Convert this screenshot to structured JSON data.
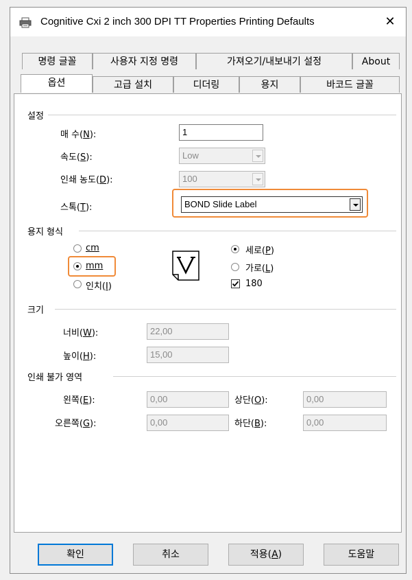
{
  "window": {
    "title": "Cognitive Cxi 2 inch 300 DPI TT Properties Printing Defaults",
    "close_glyph": "✕"
  },
  "tabs_row1": [
    "명령 글꼴",
    "사용자 지정 명령",
    "가져오기/내보내기 설정",
    "About"
  ],
  "tabs_row2": [
    "옵션",
    "고급 설치",
    "디더링",
    "용지",
    "바코드 글꼴"
  ],
  "active_tab": "옵션",
  "settings": {
    "group": "설정",
    "copies_label": "매 수(",
    "copies_key": "N",
    "copies_value": "1",
    "speed_label": "속도(",
    "speed_key": "S",
    "speed_value": "Low",
    "darkness_label": "인쇄 농도(",
    "darkness_key": "D",
    "darkness_value": "100",
    "stock_label": "스톡(",
    "stock_key": "T",
    "stock_value": "BOND Slide Label"
  },
  "paper_format": {
    "group": "용지 형식",
    "unit_cm": "cm",
    "unit_mm": "mm",
    "unit_inch": "인치(",
    "unit_inch_key": "I",
    "selected_unit": "mm",
    "portrait_label": "세로(",
    "portrait_key": "P",
    "landscape_label": "가로(",
    "landscape_key": "L",
    "selected_orientation": "portrait",
    "rotate_label": "180",
    "rotate_checked": true
  },
  "size": {
    "group": "크기",
    "width_label": "너비(",
    "width_key": "W",
    "width_value": "22,00",
    "height_label": "높이(",
    "height_key": "H",
    "height_value": "15,00"
  },
  "unprintable": {
    "group": "인쇄 불가 영역",
    "left_label": "왼쪽(",
    "left_key": "E",
    "left_value": "0,00",
    "top_label": "상단(",
    "top_key": "O",
    "top_value": "0,00",
    "right_label": "오른쪽(",
    "right_key": "G",
    "right_value": "0,00",
    "bottom_label": "하단(",
    "bottom_key": "B",
    "bottom_value": "0,00"
  },
  "buttons": {
    "ok": "확인",
    "cancel": "취소",
    "apply_label": "적용(",
    "apply_key": "A",
    "help": "도움말"
  },
  "highlight_color": "#f08a38",
  "icons": [
    "printer-icon",
    "close-icon",
    "portrait-paper-icon",
    "dropdown-arrow-icon"
  ]
}
